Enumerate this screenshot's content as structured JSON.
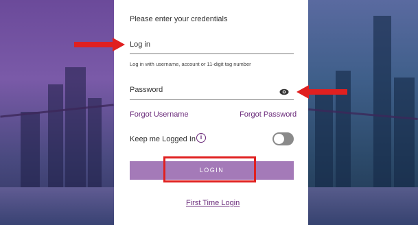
{
  "form": {
    "heading": "Please enter your credentials",
    "login_placeholder": "Log in",
    "login_hint": "Log in with username, account or 11-digit tag number",
    "password_placeholder": "Password",
    "forgot_username": "Forgot Username",
    "forgot_password": "Forgot Password",
    "keep_logged_in": "Keep me Logged In",
    "keep_logged_in_enabled": false,
    "info_symbol": "i",
    "login_button": "LOGIN",
    "first_time_login": "First Time Login"
  },
  "icons": {
    "password_toggle": "eye-icon",
    "info": "info-icon"
  },
  "colors": {
    "accent": "#6a2a7a",
    "button": "#a47ab8",
    "annotation": "#e02020"
  }
}
